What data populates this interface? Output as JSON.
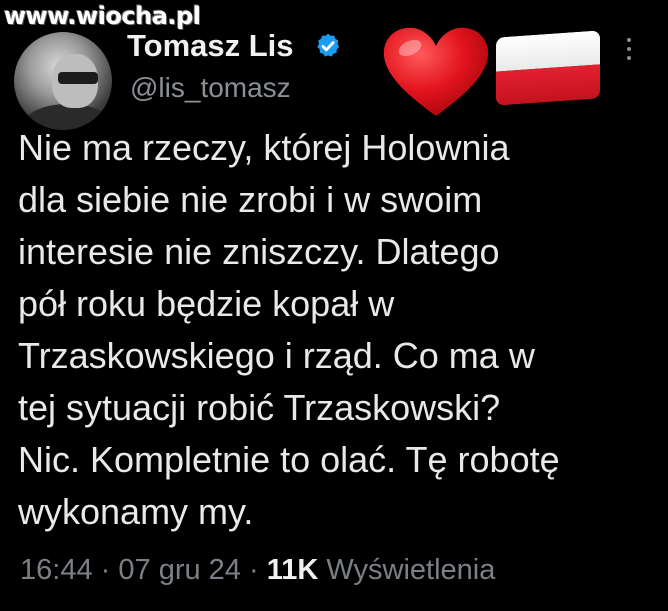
{
  "watermark": "www.wiocha.pl",
  "author": {
    "display_name": "Tomasz Lis",
    "handle": "@lis_tomasz",
    "verified": true,
    "verified_color": "#1d9bf0"
  },
  "emojis": [
    "red-heart",
    "poland-flag"
  ],
  "tweet": {
    "lines": [
      "Nie ma rzeczy, której Holownia",
      "dla siebie nie zrobi i w swoim",
      "interesie nie zniszczy. Dlatego",
      "pół roku będzie kopał w",
      "Trzaskowskiego i rząd. Co ma w",
      "tej sytuacji robić Trzaskowski?",
      "Nic. Kompletnie to olać. Tę robotę",
      "wykonamy my."
    ]
  },
  "meta": {
    "time": "16:44",
    "separator": "·",
    "date": "07 gru 24",
    "views_count": "11K",
    "views_label": "Wyświetlenia"
  }
}
